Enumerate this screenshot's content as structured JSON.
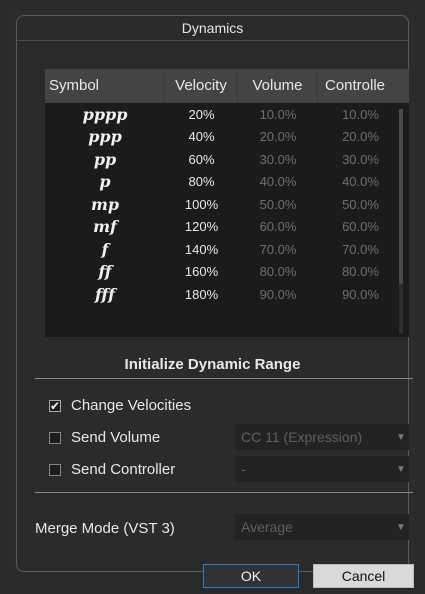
{
  "dialog": {
    "title": "Dynamics"
  },
  "table": {
    "columns": [
      "Symbol",
      "Velocity",
      "Volume",
      "Controlle"
    ],
    "rows": [
      {
        "symbol": "pppp",
        "velocity": "20%",
        "volume": "10.0%",
        "controller": "10.0%"
      },
      {
        "symbol": "ppp",
        "velocity": "40%",
        "volume": "20.0%",
        "controller": "20.0%"
      },
      {
        "symbol": "pp",
        "velocity": "60%",
        "volume": "30.0%",
        "controller": "30.0%"
      },
      {
        "symbol": "p",
        "velocity": "80%",
        "volume": "40.0%",
        "controller": "40.0%"
      },
      {
        "symbol": "mp",
        "velocity": "100%",
        "volume": "50.0%",
        "controller": "50.0%"
      },
      {
        "symbol": "mf",
        "velocity": "120%",
        "volume": "60.0%",
        "controller": "60.0%"
      },
      {
        "symbol": "f",
        "velocity": "140%",
        "volume": "70.0%",
        "controller": "70.0%"
      },
      {
        "symbol": "ff",
        "velocity": "160%",
        "volume": "80.0%",
        "controller": "80.0%"
      },
      {
        "symbol": "fff",
        "velocity": "180%",
        "volume": "90.0%",
        "controller": "90.0%"
      }
    ]
  },
  "init_section": {
    "title": "Initialize Dynamic Range",
    "change_velocities": {
      "label": "Change Velocities",
      "checked": true
    },
    "send_volume": {
      "label": "Send Volume",
      "checked": false,
      "value": "CC 11 (Expression)"
    },
    "send_controller": {
      "label": "Send Controller",
      "checked": false,
      "value": "-"
    }
  },
  "merge_mode": {
    "label": "Merge Mode (VST 3)",
    "value": "Average"
  },
  "buttons": {
    "ok": "OK",
    "cancel": "Cancel"
  }
}
